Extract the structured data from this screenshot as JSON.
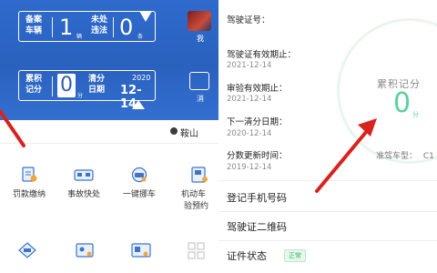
{
  "left": {
    "registered_vehicles": {
      "label1": "备案",
      "label2": "车辆",
      "value": "1",
      "unit": "辆"
    },
    "unprocessed": {
      "label1": "未处",
      "label2": "违法",
      "value": "0",
      "unit": "条"
    },
    "score": {
      "label1": "累积",
      "label2": "记分",
      "value": "0",
      "unit": "分"
    },
    "clear_date": {
      "label1": "清分",
      "label2": "日期",
      "year": "2020",
      "date": "12-14"
    },
    "side_labels": [
      "我",
      "消"
    ],
    "location": "鞍山",
    "services": [
      {
        "label": "罚款缴纳"
      },
      {
        "label": "事故快处"
      },
      {
        "label": "一键挪车"
      },
      {
        "label": "机动车",
        "label2": "验预约"
      }
    ],
    "colors": {
      "brand_blue": "#2f6bcc"
    }
  },
  "right": {
    "license_no_label": "驾驶证号：",
    "fields": [
      {
        "label": "驾驶证有效期止：",
        "value": "2021-12-14"
      },
      {
        "label": "审验有效期止：",
        "value": "2021-12-14"
      },
      {
        "label": "下一清分日期：",
        "value": "2020-12-14"
      },
      {
        "label": "分数更新时间：",
        "value": "2019-12-14"
      }
    ],
    "score_title": "累积记分",
    "score_value": "0",
    "score_unit": "分",
    "license_type_label": "准驾车型：",
    "license_type_value": "C1",
    "rows": [
      {
        "label": "登记手机号码"
      },
      {
        "label": "驾驶证二维码"
      },
      {
        "label": "证件状态",
        "badge": "正常"
      }
    ],
    "colors": {
      "score_green": "#5bd19d",
      "badge_green": "#38b36a"
    }
  }
}
